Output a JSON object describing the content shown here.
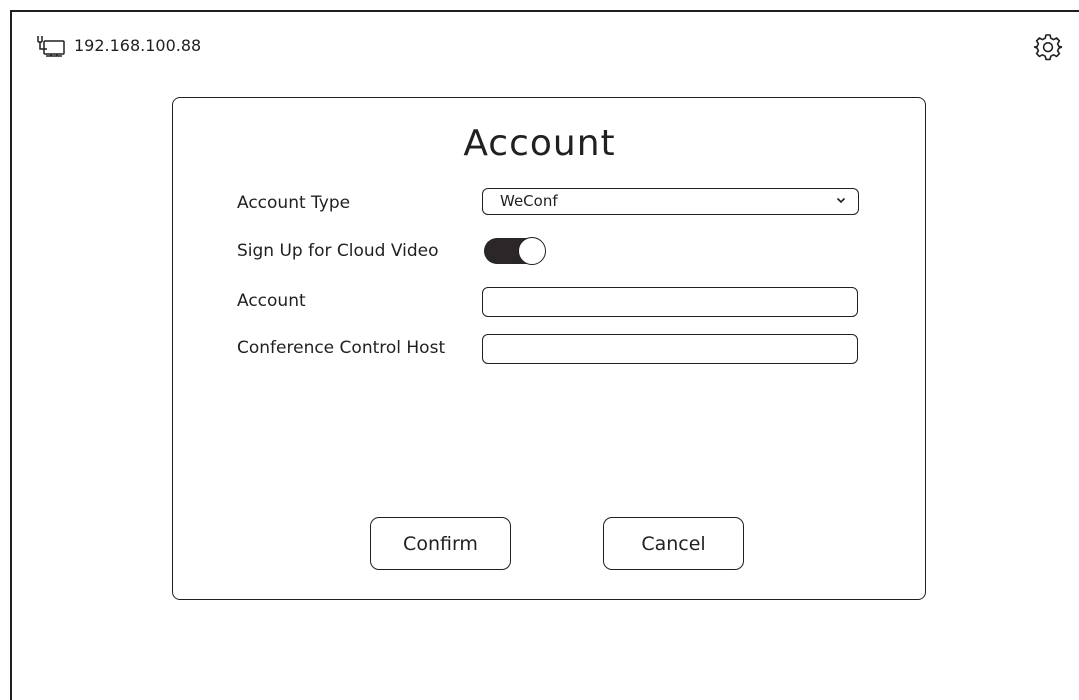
{
  "status_bar": {
    "network_icon": "wired-network-monitor-icon",
    "ip_address": "192.168.100.88",
    "settings_icon": "gear-icon"
  },
  "dialog": {
    "title": "Account",
    "fields": {
      "account_type": {
        "label": "Account Type",
        "selected": "WeConf",
        "chevron_icon": "chevron-down-icon"
      },
      "cloud_video": {
        "label": "Sign Up for Cloud Video",
        "enabled": true
      },
      "account": {
        "label": "Account",
        "value": ""
      },
      "conference_host": {
        "label": "Conference Control Host",
        "value": ""
      }
    },
    "buttons": {
      "confirm": "Confirm",
      "cancel": "Cancel"
    }
  },
  "colors": {
    "foreground": "#231f20",
    "toggle_on": "#2b2627",
    "background": "#ffffff"
  }
}
